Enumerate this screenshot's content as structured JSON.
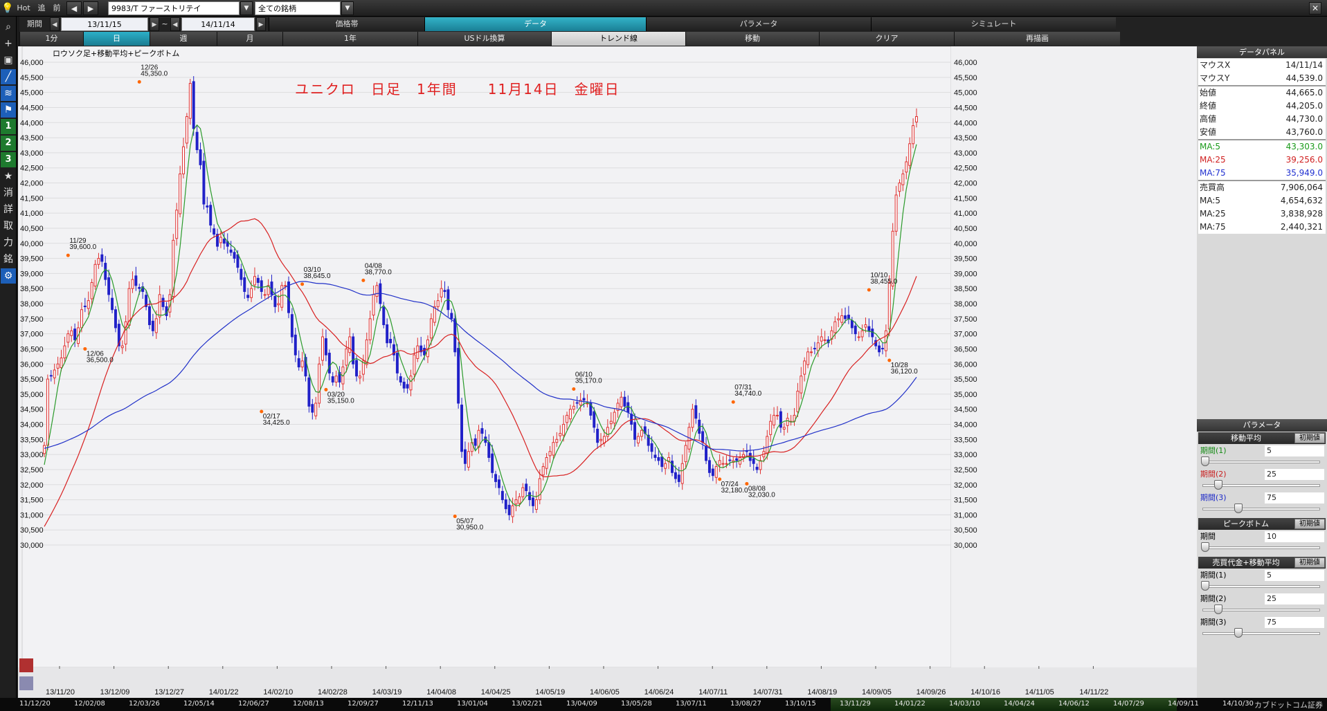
{
  "toolbar": {
    "hot": "Hot",
    "follow": "追",
    "prev": "前",
    "symbol": "9983/T ファーストリテイ",
    "universe": "全ての銘柄"
  },
  "row2": {
    "period_label": "期間",
    "start_date": "13/11/15",
    "tilde": "~",
    "end_date": "14/11/14",
    "tabs": [
      "価格帯",
      "データ",
      "パラメータ",
      "シミュレート"
    ],
    "active_tab": 1
  },
  "row3": {
    "buttons": [
      "1分",
      "日",
      "週",
      "月",
      "1年",
      "USドル換算",
      "トレンド線",
      "移動",
      "クリア",
      "再描画"
    ],
    "active": 1,
    "light": [
      6
    ]
  },
  "left_tools": [
    "search",
    "plus",
    "camera",
    "chart-line",
    "chart-multi",
    "flag",
    "1",
    "2",
    "3",
    "★",
    "消",
    "詳",
    "取",
    "力",
    "銘",
    "gear"
  ],
  "chart_caption": "ロウソク足+移動平均+ピークボトム",
  "chart_title": "ユニクロ　日足　1年間　　11月14日　金曜日",
  "chart_data": {
    "type": "candlestick",
    "title": "ユニクロ　日足　1年間　　11月14日　金曜日",
    "subtitle": "ロウソク足+移動平均+ピークボトム",
    "ylim": [
      30000,
      46500
    ],
    "y_ticks": [
      "30,000",
      "30,500",
      "31,000",
      "31,500",
      "32,000",
      "32,500",
      "33,000",
      "33,500",
      "34,000",
      "34,500",
      "35,000",
      "35,500",
      "36,000",
      "36,500",
      "37,000",
      "37,500",
      "38,000",
      "38,500",
      "39,000",
      "39,500",
      "40,000",
      "40,500",
      "41,000",
      "41,500",
      "42,000",
      "42,500",
      "43,000",
      "43,500",
      "44,000",
      "44,500",
      "45,000",
      "45,500",
      "46,000"
    ],
    "x_ticks": [
      "13/11/20",
      "13/12/09",
      "13/12/27",
      "14/01/22",
      "14/02/10",
      "14/02/28",
      "14/03/19",
      "14/04/08",
      "14/04/25",
      "14/05/19",
      "14/06/05",
      "14/06/24",
      "14/07/11",
      "14/07/31",
      "14/08/19",
      "14/09/05",
      "14/09/26",
      "14/10/16",
      "14/11/05",
      "14/11/22"
    ],
    "close": [
      33300,
      35500,
      35600,
      35800,
      36000,
      36200,
      36600,
      37000,
      37100,
      36800,
      37200,
      37800,
      37900,
      38100,
      38700,
      39300,
      39500,
      39400,
      38800,
      38300,
      37800,
      37200,
      36600,
      36600,
      37400,
      38500,
      38800,
      38600,
      38500,
      38400,
      37900,
      37300,
      37100,
      37500,
      38300,
      37900,
      37600,
      38300,
      40100,
      41100,
      42300,
      43200,
      44200,
      45300,
      43800,
      43100,
      42600,
      41300,
      41200,
      40600,
      40300,
      39900,
      40200,
      40000,
      39900,
      39700,
      39500,
      39200,
      38800,
      38400,
      38200,
      38500,
      38900,
      38700,
      38400,
      38300,
      38600,
      38300,
      37900,
      38000,
      38600,
      38600,
      37700,
      36900,
      36300,
      35900,
      36100,
      35600,
      34600,
      34400,
      34700,
      36000,
      36900,
      36300,
      35700,
      35400,
      35600,
      35400,
      35900,
      36500,
      36900,
      36000,
      35600,
      35600,
      36100,
      36800,
      37500,
      38300,
      38600,
      38000,
      37300,
      36700,
      36700,
      36300,
      35700,
      35400,
      35200,
      35200,
      35600,
      36300,
      36600,
      36400,
      36300,
      36800,
      37500,
      37900,
      38100,
      38500,
      38400,
      37800,
      37500,
      36400,
      34700,
      33100,
      32700,
      33100,
      33400,
      33300,
      33800,
      33700,
      33400,
      32900,
      32400,
      32100,
      31900,
      31500,
      31200,
      31000,
      31300,
      31500,
      31600,
      31900,
      31800,
      31500,
      31300,
      31500,
      32200,
      32600,
      32900,
      33100,
      33400,
      33500,
      33700,
      34000,
      34300,
      34500,
      34600,
      34700,
      34800,
      34800,
      34700,
      34300,
      33900,
      33400,
      33500,
      33600,
      33900,
      34100,
      34400,
      34700,
      34900,
      34600,
      34400,
      34000,
      33500,
      33600,
      33800,
      33700,
      33300,
      33100,
      32900,
      32800,
      32600,
      32700,
      32900,
      32400,
      32200,
      32100,
      32700,
      33300,
      33900,
      34500,
      34200,
      33700,
      33400,
      32800,
      32400,
      32300,
      32600,
      32800,
      32700,
      32700,
      32800,
      32800,
      32800,
      32900,
      33000,
      33100,
      32800,
      32700,
      32500,
      32800,
      33100,
      33600,
      34100,
      34300,
      34300,
      33900,
      33900,
      34200,
      34100,
      34300,
      35100,
      35600,
      36100,
      36400,
      36400,
      36500,
      36700,
      36900,
      36800,
      36700,
      37100,
      37400,
      37500,
      37600,
      37500,
      37500,
      37200,
      37000,
      36900,
      37100,
      37300,
      37100,
      36900,
      36600,
      36400,
      36500,
      37100,
      38700,
      40400,
      41600,
      42000,
      42300,
      42700,
      43300,
      43900,
      44200
    ],
    "ma_periods": [
      5,
      25,
      75
    ],
    "annotations": [
      {
        "date": "11/29",
        "value": "39,600.0",
        "type": "peak"
      },
      {
        "date": "12/06",
        "value": "36,500.0",
        "type": "bottom"
      },
      {
        "date": "12/26",
        "value": "45,350.0",
        "type": "peak"
      },
      {
        "date": "02/17",
        "value": "34,425.0",
        "type": "bottom"
      },
      {
        "date": "03/10",
        "value": "38,645.0",
        "type": "peak"
      },
      {
        "date": "03/20",
        "value": "35,150.0",
        "type": "bottom"
      },
      {
        "date": "04/08",
        "value": "38,770.0",
        "type": "peak"
      },
      {
        "date": "05/07",
        "value": "30,950.0",
        "type": "bottom"
      },
      {
        "date": "06/10",
        "value": "35,170.0",
        "type": "peak"
      },
      {
        "date": "07/24",
        "value": "32,180.0",
        "type": "bottom"
      },
      {
        "date": "07/31",
        "value": "34,740.0",
        "type": "peak"
      },
      {
        "date": "08/08",
        "value": "32,030.0",
        "type": "bottom"
      },
      {
        "date": "10/10",
        "value": "38,455.0",
        "type": "peak"
      },
      {
        "date": "10/28",
        "value": "36,120.0",
        "type": "bottom"
      }
    ],
    "colors": {
      "up": "#e03030",
      "down": "#2020c8",
      "ma5": "#2a9a2a",
      "ma25": "#d82020",
      "ma75": "#2030c8",
      "marker": "#ff6600"
    }
  },
  "bottom_dates": [
    "11/12/20",
    "12/02/08",
    "12/03/26",
    "12/05/14",
    "12/06/27",
    "12/08/13",
    "12/09/27",
    "12/11/13",
    "13/01/04",
    "13/02/21",
    "13/04/09",
    "13/05/28",
    "13/07/11",
    "13/08/27",
    "13/10/15",
    "13/11/29",
    "14/01/22",
    "14/03/10",
    "14/04/24",
    "14/06/12",
    "14/07/29",
    "14/09/11",
    "14/10/30"
  ],
  "bottom_brand": "カブドットコム証券",
  "data_panel": {
    "title": "データパネル",
    "rows": [
      {
        "k": "マウスX",
        "v": "14/11/14",
        "c": ""
      },
      {
        "k": "マウスY",
        "v": "44,539.0",
        "c": ""
      },
      {
        "k": "始値",
        "v": "44,665.0",
        "c": ""
      },
      {
        "k": "終値",
        "v": "44,205.0",
        "c": ""
      },
      {
        "k": "高値",
        "v": "44,730.0",
        "c": ""
      },
      {
        "k": "安値",
        "v": "43,760.0",
        "c": ""
      },
      {
        "k": "MA:5",
        "v": "43,303.0",
        "c": "c-green"
      },
      {
        "k": "MA:25",
        "v": "39,256.0",
        "c": "c-red"
      },
      {
        "k": "MA:75",
        "v": "35,949.0",
        "c": "c-blue"
      },
      {
        "k": "売買高",
        "v": "7,906,064",
        "c": ""
      },
      {
        "k": "MA:5",
        "v": "4,654,632",
        "c": ""
      },
      {
        "k": "MA:25",
        "v": "3,838,928",
        "c": ""
      },
      {
        "k": "MA:75",
        "v": "2,440,321",
        "c": ""
      }
    ]
  },
  "params": {
    "title": "パラメータ",
    "reset": "初期値",
    "sections": [
      {
        "title": "移動平均",
        "items": [
          {
            "label": "期間(1)",
            "value": "5",
            "pos": 0.0,
            "cls": "on"
          },
          {
            "label": "期間(2)",
            "value": "25",
            "pos": 0.12,
            "cls": "on r"
          },
          {
            "label": "期間(3)",
            "value": "75",
            "pos": 0.3,
            "cls": "on b"
          }
        ]
      },
      {
        "title": "ピークボトム",
        "items": [
          {
            "label": "期間",
            "value": "10",
            "pos": 0.0,
            "cls": ""
          }
        ]
      },
      {
        "title": "売買代金+移動平均",
        "items": [
          {
            "label": "期間(1)",
            "value": "5",
            "pos": 0.0,
            "cls": ""
          },
          {
            "label": "期間(2)",
            "value": "25",
            "pos": 0.12,
            "cls": ""
          },
          {
            "label": "期間(3)",
            "value": "75",
            "pos": 0.3,
            "cls": ""
          }
        ]
      }
    ]
  }
}
